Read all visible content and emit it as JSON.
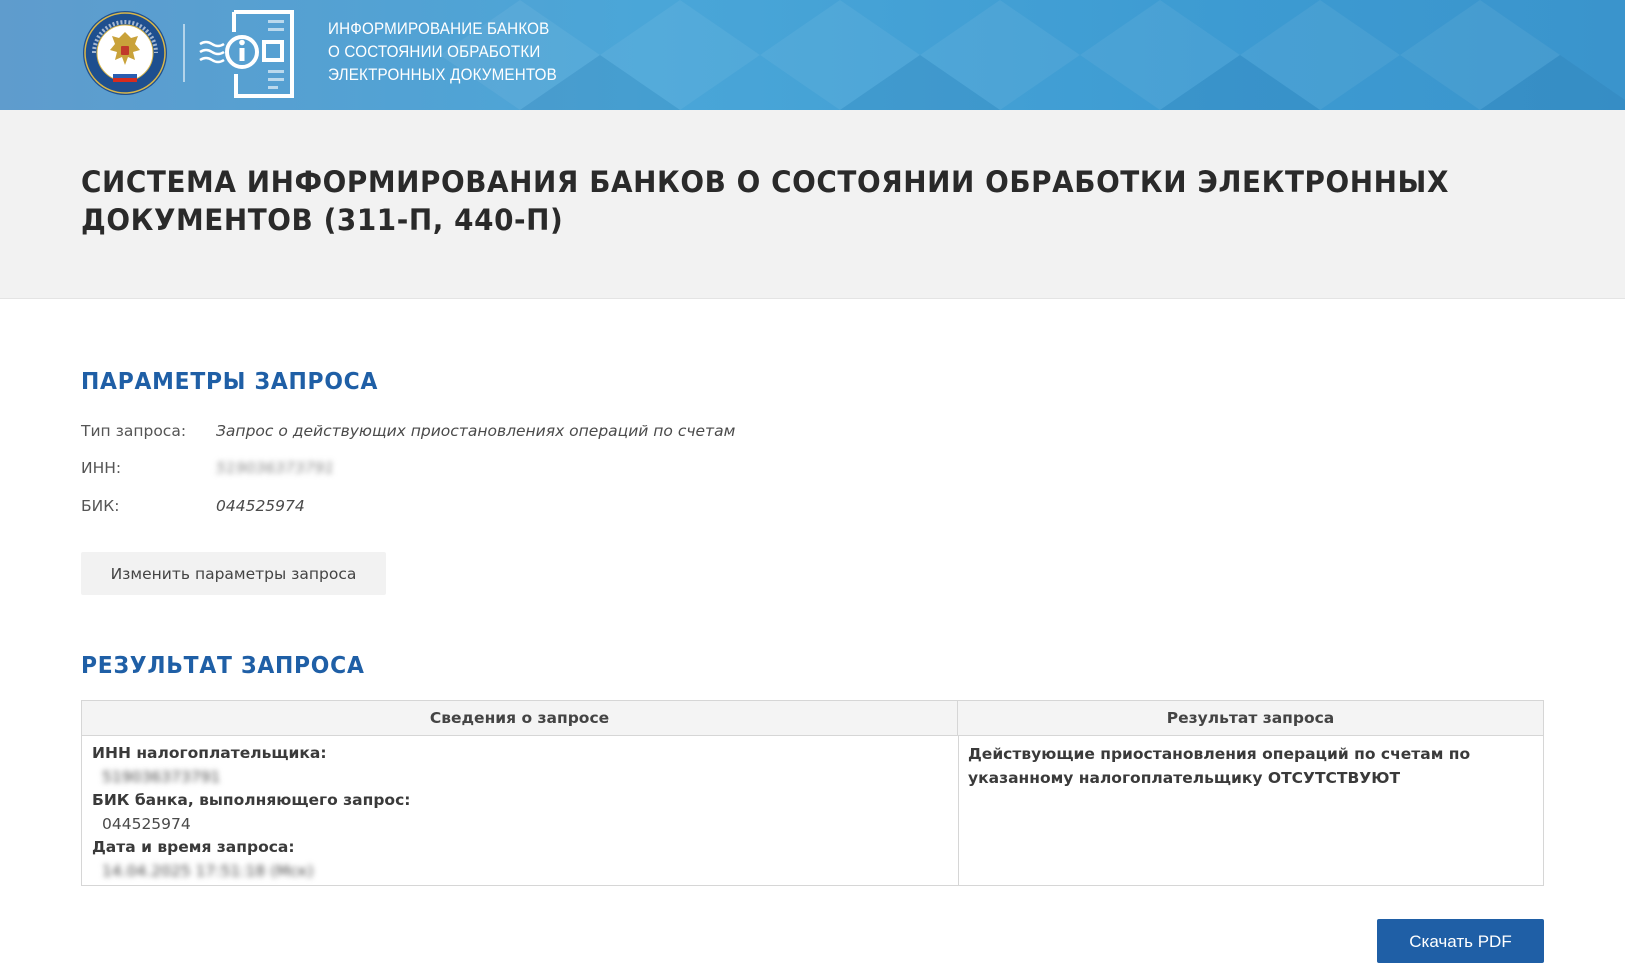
{
  "banner": {
    "title_lines": [
      "ИНФОРМИРОВАНИЕ БАНКОВ",
      "О СОСТОЯНИИ ОБРАБОТКИ",
      "ЭЛЕКТРОННЫХ ДОКУМЕНТОВ"
    ],
    "emblem_icon": "fns-emblem-icon",
    "service_icon": "info-document-icon",
    "emblem_text": "ФЕДЕРАЛЬНАЯ НАЛОГОВАЯ СЛУЖБА"
  },
  "page": {
    "title": "СИСТЕМА ИНФОРМИРОВАНИЯ БАНКОВ О СОСТОЯНИИ ОБРАБОТКИ ЭЛЕКТРОННЫХ ДОКУМЕНТОВ (311-П, 440-П)"
  },
  "params": {
    "heading": "ПАРАМЕТРЫ ЗАПРОСА",
    "rows": [
      {
        "label": "Тип запроса:",
        "value": "Запрос о действующих приостановлениях операций по счетам"
      },
      {
        "label": "ИНН:",
        "value": "519036373791"
      },
      {
        "label": "БИК:",
        "value": "044525974"
      }
    ],
    "change_button": "Изменить параметры запроса"
  },
  "results": {
    "heading": "РЕЗУЛЬТАТ ЗАПРОСА",
    "columns": [
      "Сведения о запросе",
      "Результат запроса"
    ],
    "info": [
      {
        "label": "ИНН налогоплательщика:",
        "value": "519036373791"
      },
      {
        "label": "БИК банка, выполняющего запрос:",
        "value": "044525974"
      },
      {
        "label": "Дата и время запроса:",
        "value": "14.04.2025 17:51:18 (Мск)"
      }
    ],
    "result_text": "Действующие приостановления операций по счетам по указанному налогоплательщику ОТСУТСТВУЮТ"
  },
  "download_button": "Скачать PDF",
  "colors": {
    "accent": "#1f5fa6",
    "banner": "#4aa6d8",
    "header_bg": "#f2f2f2"
  }
}
